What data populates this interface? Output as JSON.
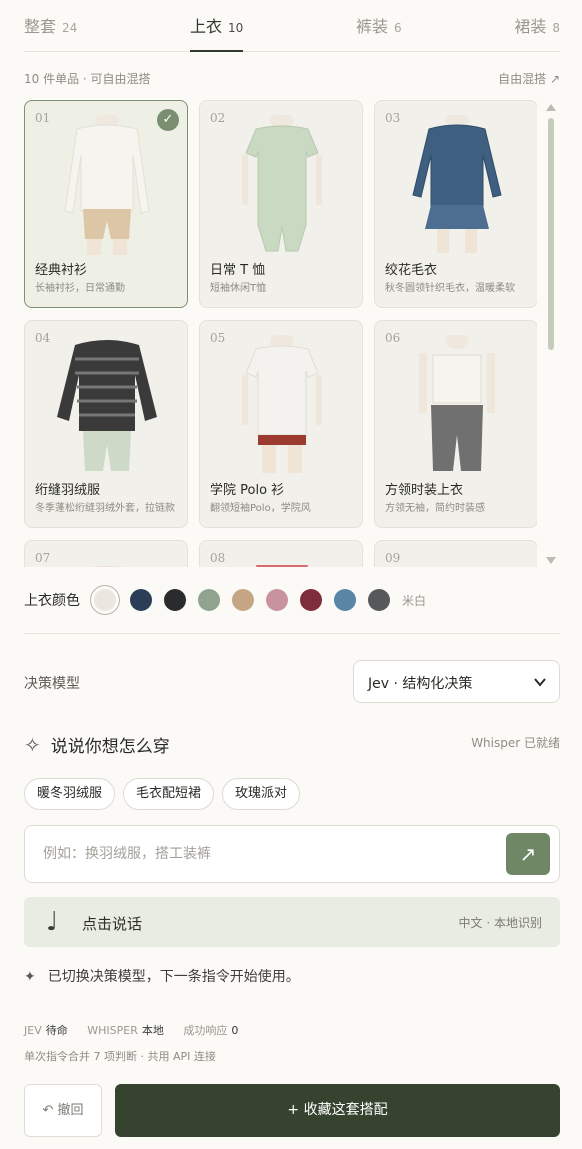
{
  "tabs": [
    {
      "label": "整套",
      "count": "24"
    },
    {
      "label": "上衣",
      "count": "10"
    },
    {
      "label": "裤装",
      "count": "6"
    },
    {
      "label": "裙装",
      "count": "8"
    }
  ],
  "list_summary": "10 件单品 · 可自由混搭",
  "mix_link": "自由混搭 ↗",
  "items": [
    {
      "num": "01",
      "name": "经典衬衫",
      "desc": "长袖衬衫，日常通勤",
      "selected": true
    },
    {
      "num": "02",
      "name": "日常 T 恤",
      "desc": "短袖休闲T恤"
    },
    {
      "num": "03",
      "name": "绞花毛衣",
      "desc": "秋冬圆领针织毛衣，温暖柔软"
    },
    {
      "num": "04",
      "name": "绗缝羽绒服",
      "desc": "冬季蓬松绗缝羽绒外套，拉链款"
    },
    {
      "num": "05",
      "name": "学院 Polo 衫",
      "desc": "翻领短袖Polo，学院风"
    },
    {
      "num": "06",
      "name": "方领时装上衣",
      "desc": "方领无袖，简约时装感"
    },
    {
      "num": "07",
      "name": "",
      "desc": ""
    },
    {
      "num": "08",
      "name": "",
      "desc": ""
    },
    {
      "num": "09",
      "name": "",
      "desc": ""
    }
  ],
  "color_picker": {
    "label": "上衣颜色",
    "selected_name": "米白",
    "swatches": [
      "#ebe7de",
      "#2c3e55",
      "#2a2b2d",
      "#8fa38e",
      "#c4a686",
      "#c8939e",
      "#7e2d3c",
      "#5a86a6",
      "#57585a"
    ]
  },
  "model": {
    "label": "决策模型",
    "selected": "Jev · 结构化决策"
  },
  "voice": {
    "heading": "说说你想怎么穿",
    "status": "Whisper 已就绪",
    "chips": [
      "暖冬羽绒服",
      "毛衣配短裙",
      "玫瑰派对"
    ],
    "placeholder": "例如：换羽绒服，搭工装裤",
    "talk_label": "点击说话",
    "talk_hint": "中文 · 本地识别"
  },
  "notice": "已切换决策模型，下一条指令开始使用。",
  "stats": {
    "jev_label": "JEV",
    "jev_value": "待命",
    "whisper_label": "WHISPER",
    "whisper_value": "本地",
    "success_label": "成功响应",
    "success_value": "0",
    "note": "单次指令合并 7 项判断 · 共用 API 连接"
  },
  "actions": {
    "undo": "↶ 撤回",
    "save": "+ 收藏这套搭配"
  }
}
